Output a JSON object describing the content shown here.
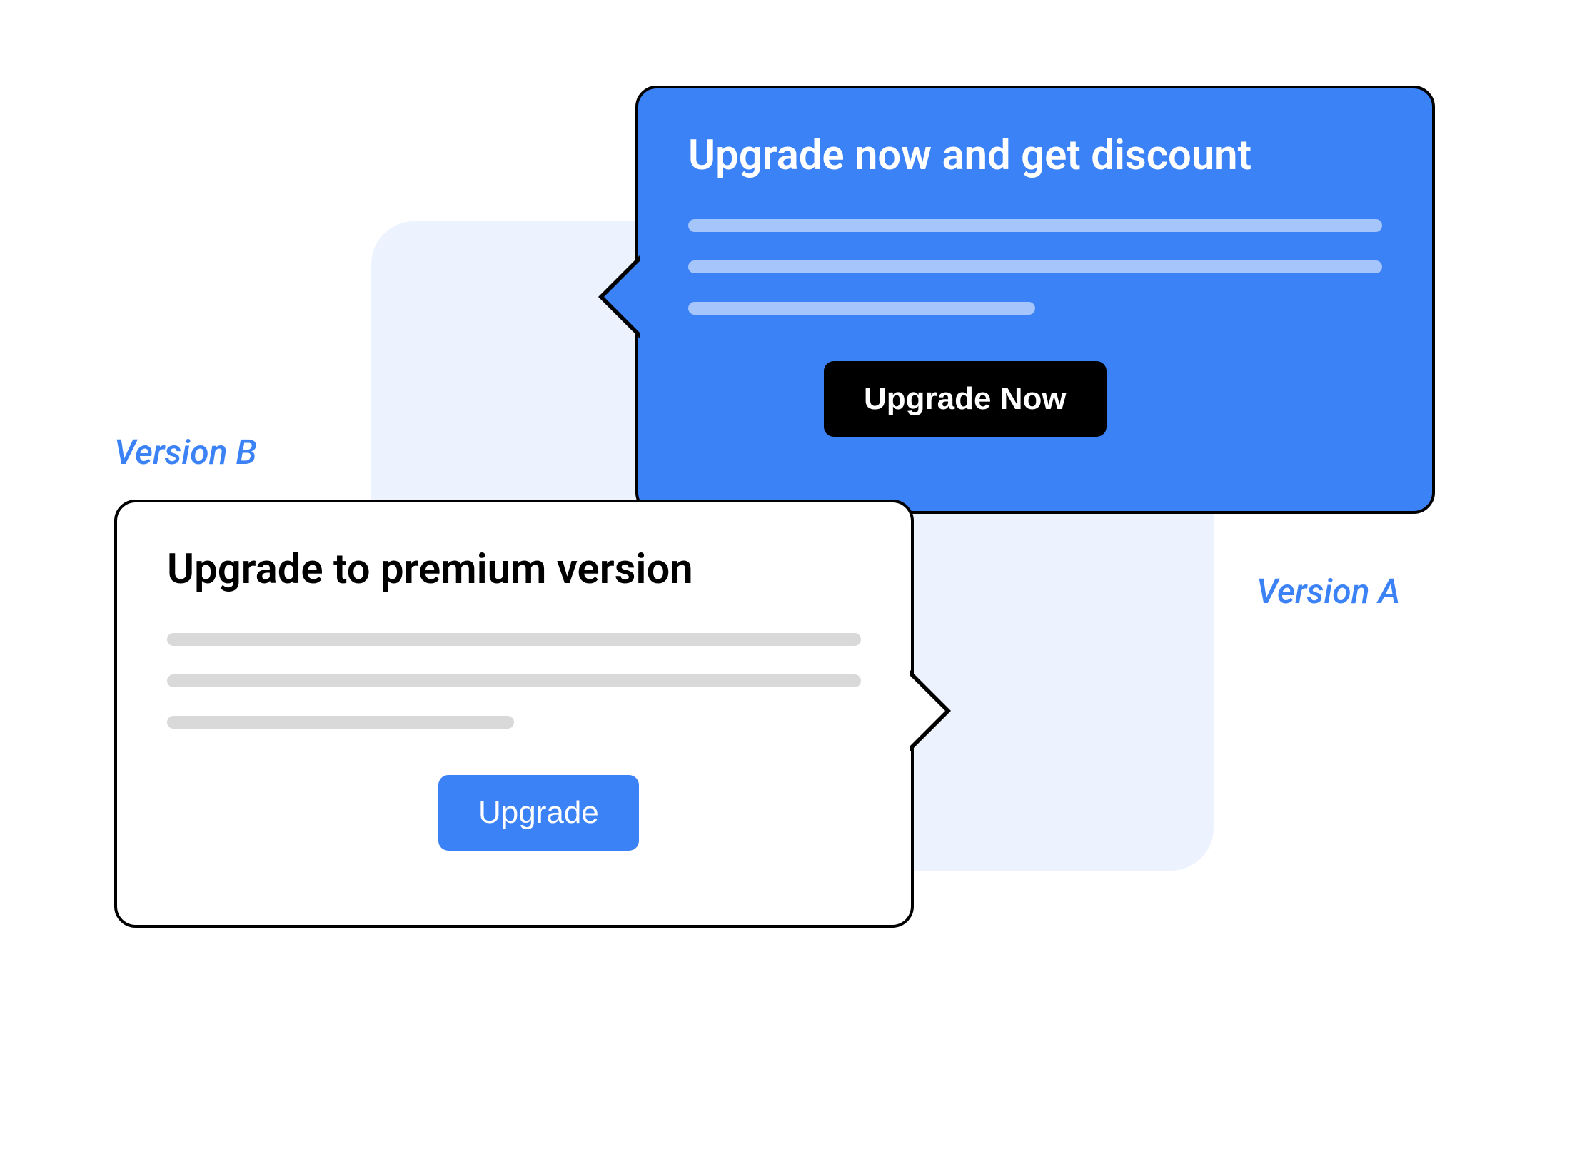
{
  "labels": {
    "version_a": "Version A",
    "version_b": "Version B"
  },
  "card_a": {
    "title": "Upgrade now and get discount",
    "button_label": "Upgrade Now"
  },
  "card_b": {
    "title": "Upgrade to premium version",
    "button_label": "Upgrade"
  },
  "colors": {
    "accent_blue": "#3b82f6",
    "light_blue_bg": "#edf2ff",
    "placeholder_blue": "#a5c5fb",
    "placeholder_gray": "#d9d9d9",
    "black": "#000000",
    "white": "#ffffff"
  }
}
